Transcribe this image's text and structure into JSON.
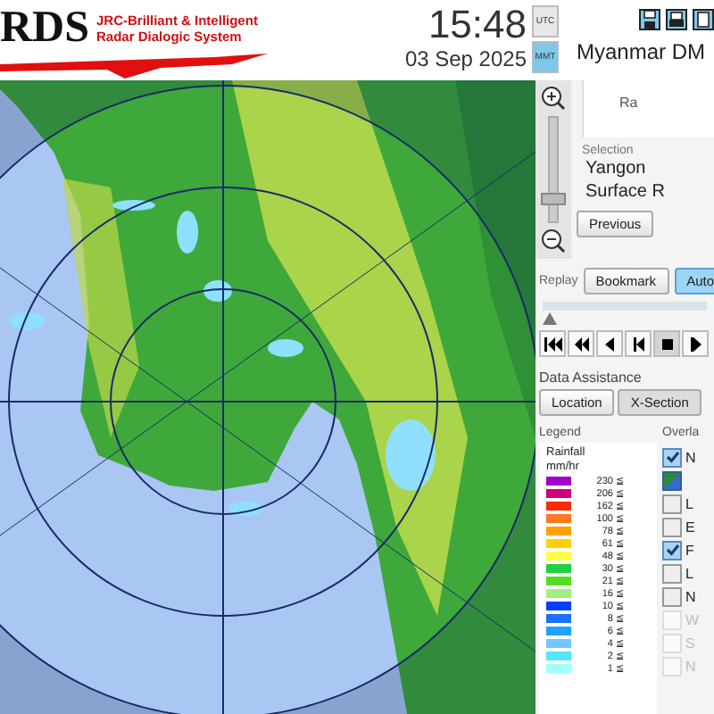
{
  "header": {
    "logo_text": "RDS",
    "logo_subtitle": [
      "JRC-Brilliant & Intelligent",
      "Radar Dialogic System"
    ],
    "time": "15:48",
    "date": "03 Sep 2025",
    "time_zones": [
      {
        "label": "UTC",
        "selected": false
      },
      {
        "label": "MMT",
        "selected": true
      }
    ],
    "site": "Myanmar DM"
  },
  "zoom": {
    "level": 0.15
  },
  "info_box": {
    "label": "Ra"
  },
  "selection": {
    "title": "Selection",
    "items": [
      "Yangon",
      "Surface R"
    ]
  },
  "previous_button": "Previous",
  "replay": {
    "label": "Replay",
    "buttons": [
      {
        "label": "Bookmark",
        "selected": false
      },
      {
        "label": "Auto",
        "selected": true
      }
    ],
    "level": 0
  },
  "data_assistance": {
    "title": "Data Assistance",
    "buttons": [
      {
        "label": "Location",
        "selected": false
      },
      {
        "label": "X-Section",
        "selected": true
      }
    ]
  },
  "legend": {
    "title": "Legend",
    "unit_lines": [
      "Rainfall",
      "mm/hr"
    ],
    "entries": [
      {
        "color": "#a000c8",
        "label": "230 ≦"
      },
      {
        "color": "#d0007a",
        "label": "206 ≦"
      },
      {
        "color": "#ff2a00",
        "label": "162 ≦"
      },
      {
        "color": "#ff7a20",
        "label": "100 ≦"
      },
      {
        "color": "#ffa000",
        "label": "78 ≦"
      },
      {
        "color": "#ffd000",
        "label": "61 ≦"
      },
      {
        "color": "#ffff40",
        "label": "48 ≦"
      },
      {
        "color": "#20d040",
        "label": "30 ≦"
      },
      {
        "color": "#50e020",
        "label": "21 ≦"
      },
      {
        "color": "#a0f080",
        "label": "16 ≦"
      },
      {
        "color": "#0040ff",
        "label": "10 ≦"
      },
      {
        "color": "#1a70ff",
        "label": "8 ≦"
      },
      {
        "color": "#20a0ff",
        "label": "6 ≦"
      },
      {
        "color": "#70c8ff",
        "label": "4 ≦"
      },
      {
        "color": "#50e8ff",
        "label": "2 ≦"
      },
      {
        "color": "#a0ffff",
        "label": "1 ≦"
      }
    ]
  },
  "overlays": {
    "title": "Overla",
    "items": [
      {
        "kind": "checkbox",
        "label": "N",
        "checked": true,
        "disabled": false
      },
      {
        "kind": "swatch"
      },
      {
        "kind": "checkbox",
        "label": "L",
        "checked": false,
        "disabled": false
      },
      {
        "kind": "checkbox",
        "label": "E",
        "checked": false,
        "disabled": false
      },
      {
        "kind": "checkbox",
        "label": "F",
        "checked": true,
        "disabled": false
      },
      {
        "kind": "checkbox",
        "label": "L",
        "checked": false,
        "disabled": false
      },
      {
        "kind": "checkbox",
        "label": "N",
        "checked": false,
        "disabled": false
      },
      {
        "kind": "checkbox",
        "label": "W",
        "checked": false,
        "disabled": true
      },
      {
        "kind": "checkbox",
        "label": "S",
        "checked": false,
        "disabled": true
      },
      {
        "kind": "checkbox",
        "label": "N",
        "checked": false,
        "disabled": true
      }
    ]
  }
}
